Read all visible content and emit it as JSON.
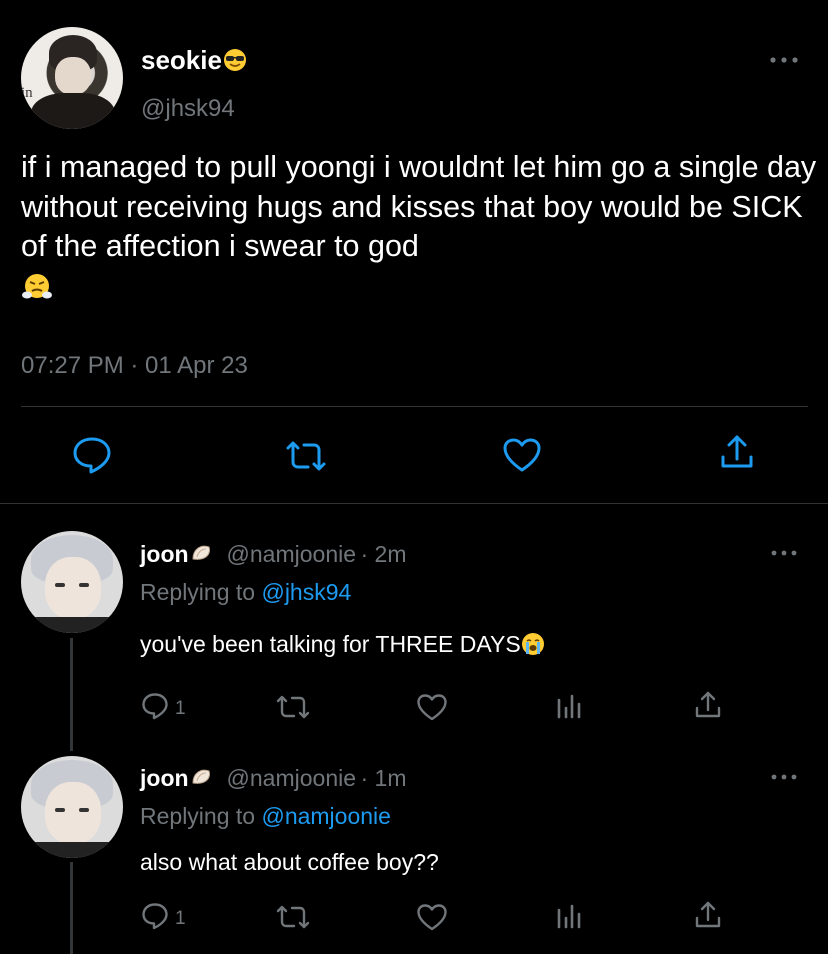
{
  "main_tweet": {
    "display_name": "seokie",
    "name_emoji": "sunglasses-emoji",
    "handle": "@jhsk94",
    "text": "if i managed to pull yoongi i wouldnt let him go a single day without receiving hugs and kisses that boy would be SICK of the affection i swear to god",
    "trailing_emoji": "face-with-steam-emoji",
    "timestamp": "07:27 PM · 01 Apr 23",
    "avatar_sign_text": "in"
  },
  "replies": [
    {
      "display_name": "joon",
      "name_emoji": "spiral-shell-emoji",
      "handle": "@namjoonie",
      "time": "· 2m",
      "replying_prefix": "Replying to",
      "replying_to": "@jhsk94",
      "text": "you've been talking for THREE DAYS",
      "trailing_emoji": "loudly-crying-face-emoji",
      "reply_count": "1"
    },
    {
      "display_name": "joon",
      "name_emoji": "spiral-shell-emoji",
      "handle": "@namjoonie",
      "time": "· 1m",
      "replying_prefix": "Replying to",
      "replying_to": "@namjoonie",
      "text": "also what about coffee boy??",
      "reply_count": "1"
    }
  ],
  "colors": {
    "background": "#000000",
    "text": "#ffffff",
    "muted": "#71767b",
    "link": "#1d9bf0",
    "divider": "#2f3336"
  }
}
